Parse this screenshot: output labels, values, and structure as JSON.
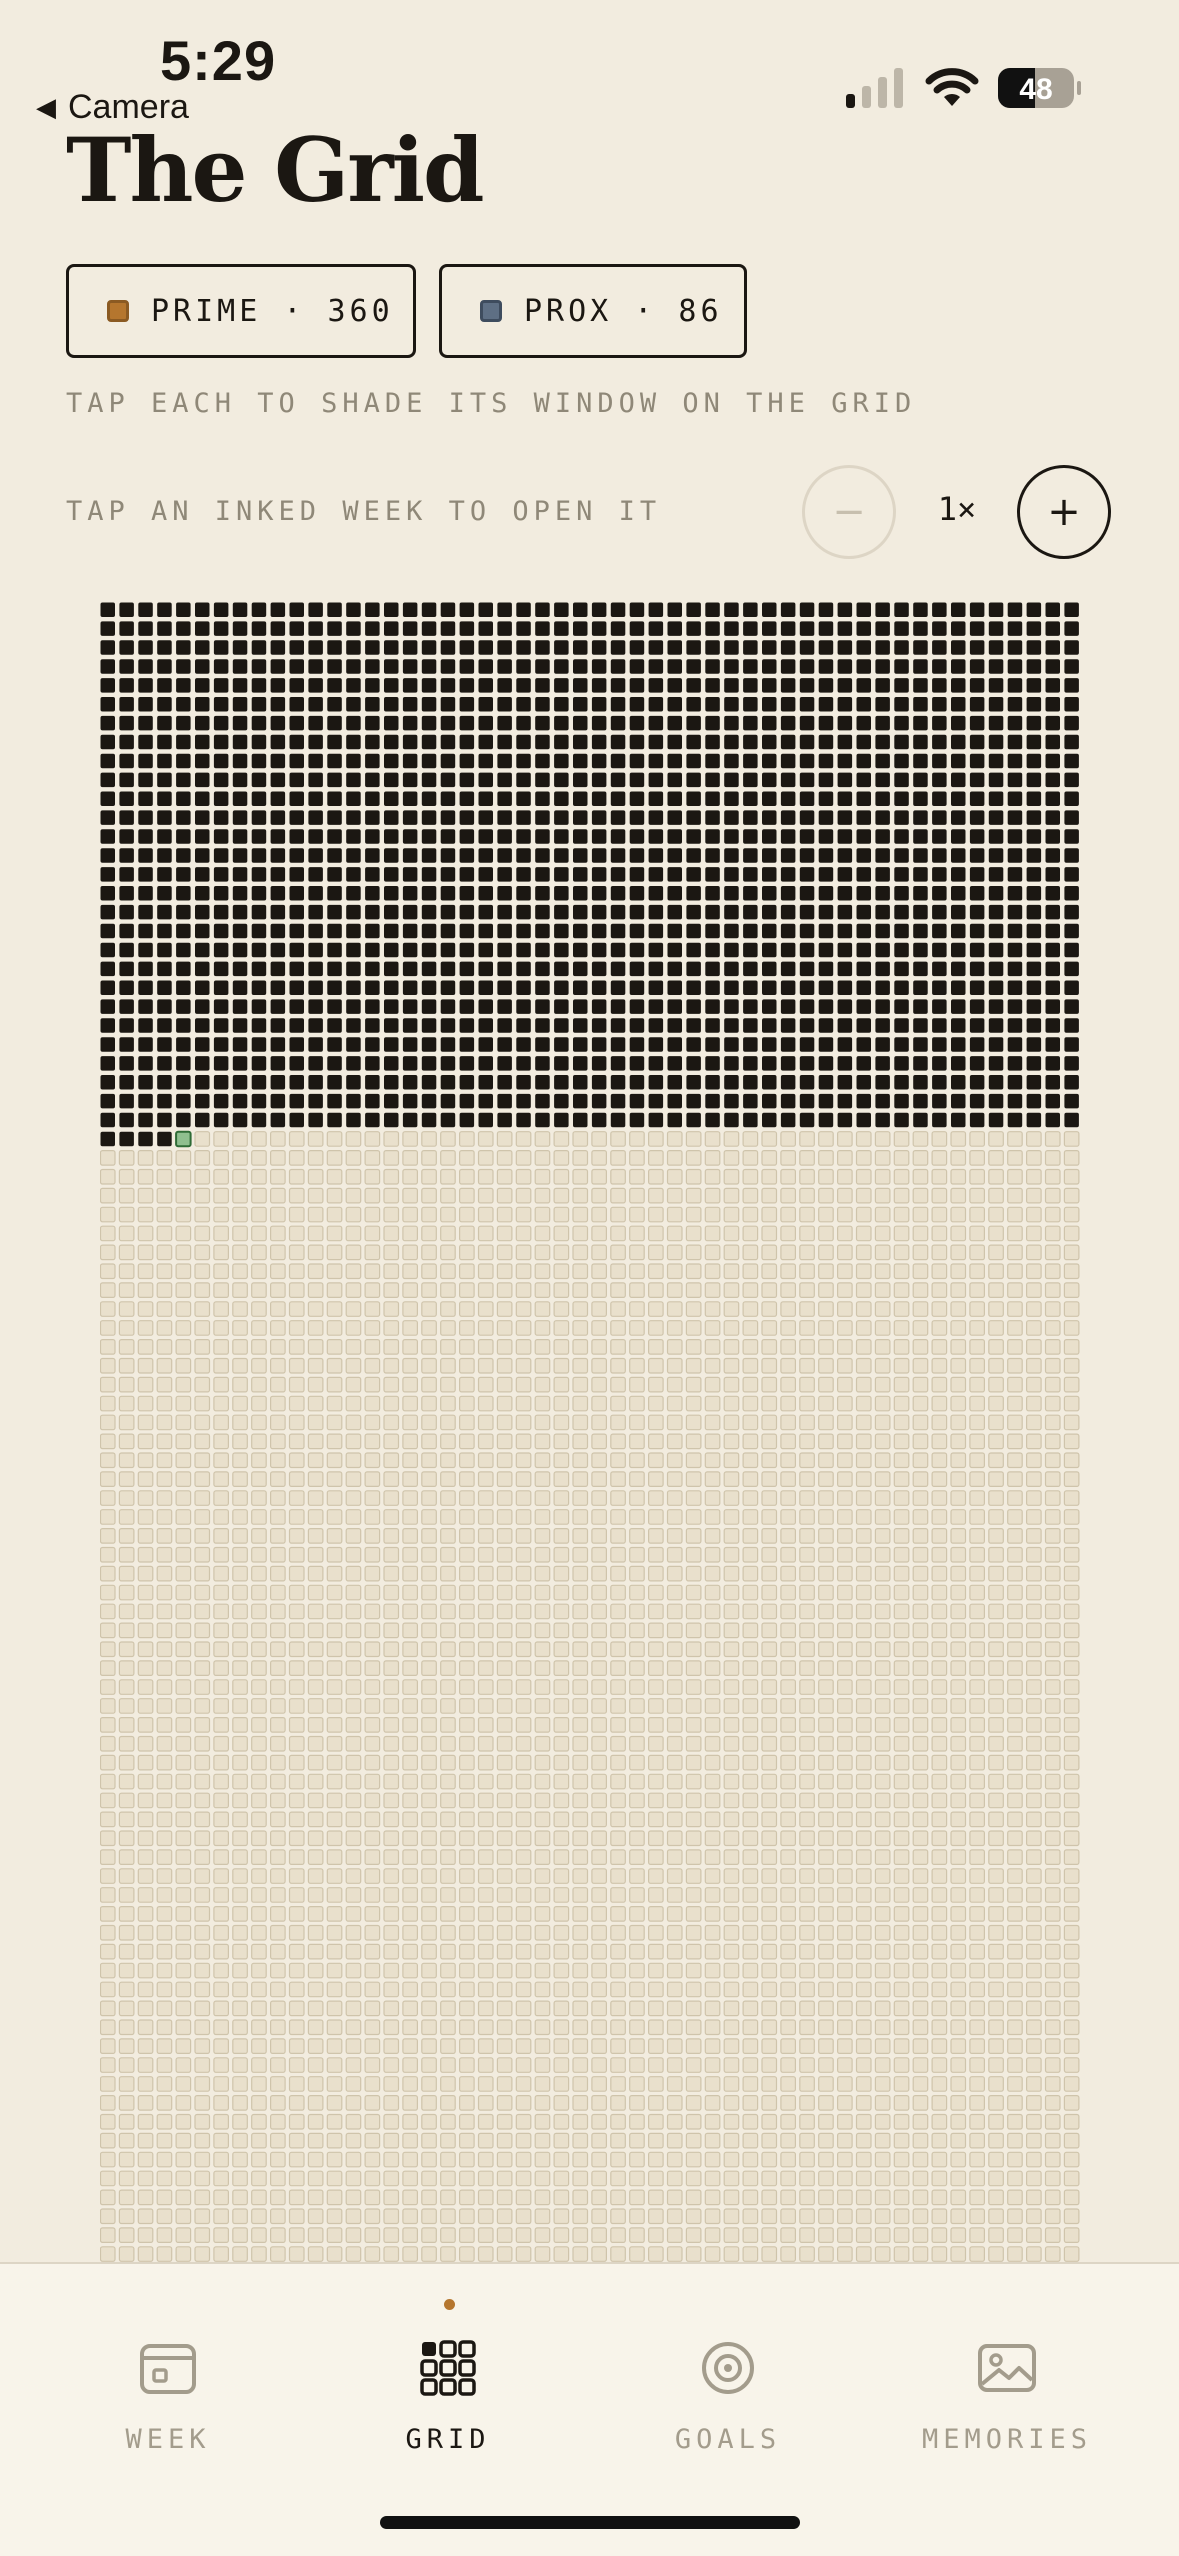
{
  "status_bar": {
    "time": "5:29",
    "back_label": "Camera",
    "battery": "48",
    "icons": [
      "signal-icon",
      "wifi-icon",
      "battery-icon"
    ]
  },
  "header": {
    "title": "The Grid"
  },
  "legend": {
    "prime": {
      "label": "PRIME · 360",
      "color": "#b5762e"
    },
    "prox": {
      "label": "PROX · 86",
      "color": "#5e6f84"
    },
    "hint": "TAP EACH TO SHADE ITS WINDOW ON THE GRID"
  },
  "zoom": {
    "hint": "TAP AN INKED WEEK TO OPEN IT",
    "minus_label": "−",
    "level": "1×",
    "plus_label": "+"
  },
  "grid": {
    "columns": 52,
    "inked_weeks": 1460,
    "current_week_index": 1460,
    "colors": {
      "inked": "#1b1712",
      "empty_fill": "#e9e0cc",
      "empty_stroke": "#cfc4ab",
      "current_fill": "#8fbf8f",
      "current_stroke": "#2f6b36"
    }
  },
  "tabbar": {
    "tabs": [
      {
        "label": "WEEK",
        "icon": "calendar-icon"
      },
      {
        "label": "GRID",
        "icon": "grid-icon",
        "active": true
      },
      {
        "label": "GOALS",
        "icon": "target-icon"
      },
      {
        "label": "MEMORIES",
        "icon": "image-icon"
      }
    ],
    "accent": "#b5762e"
  }
}
